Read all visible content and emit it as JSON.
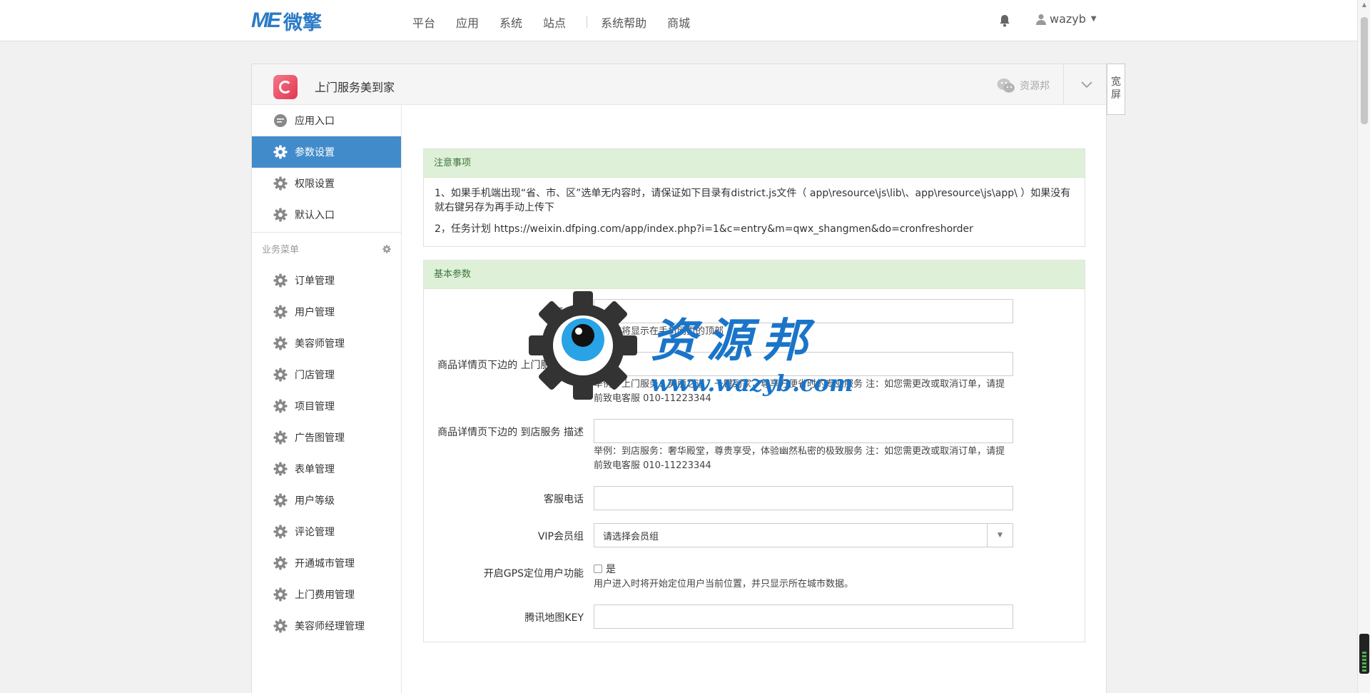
{
  "topbar": {
    "logo_mark": "ME",
    "logo_name": "微擎",
    "nav": [
      "平台",
      "应用",
      "系统",
      "站点",
      "系统帮助",
      "商城"
    ],
    "user": "wazyb"
  },
  "panel": {
    "app_title": "上门服务美到家",
    "wx_label": "资源邦",
    "wide_button": "宽屏"
  },
  "sidebar": {
    "top_items": [
      {
        "label": "应用入口",
        "icon": "chat-bubble-icon"
      },
      {
        "label": "参数设置",
        "icon": "gear-icon",
        "active": true
      },
      {
        "label": "权限设置",
        "icon": "gear-icon"
      },
      {
        "label": "默认入口",
        "icon": "gear-icon"
      }
    ],
    "group_title": "业务菜单",
    "menu": [
      "订单管理",
      "用户管理",
      "美容师管理",
      "门店管理",
      "项目管理",
      "广告图管理",
      "表单管理",
      "用户等级",
      "评论管理",
      "开通城市管理",
      "上门费用管理",
      "美容师经理管理"
    ]
  },
  "notice": {
    "title": "注意事项",
    "line1": "1、如果手机端出现“省、市、区”选单无内容时，请保证如下目录有district.js文件（ app\\resource\\js\\lib\\、app\\resource\\js\\app\\ ）如果没有就右键另存为再手动上传下",
    "line2": "2，任务计划 https://weixin.dfping.com/app/index.php?i=1&c=entry&m=qwx_shangmen&do=cronfreshorder"
  },
  "basic": {
    "title": "基本参数",
    "platform_label": "平台名",
    "platform_help": "该名称将显示在手机网页的顶部",
    "door_label": "商品详情页下边的 上门服务 描述",
    "door_help": "举例：上门服务：美丽之道，一键到家，尊享方便省时的专业服务 注：如您需更改或取消订单，请提前致电客服 010-11223344",
    "store_label": "商品详情页下边的 到店服务 描述",
    "store_help": "举例：到店服务：奢华殿堂，尊贵享受，体验幽然私密的极致服务 注：如您需更改或取消订单，请提前致电客服 010-11223344",
    "phone_label": "客服电话",
    "vip_label": "VIP会员组",
    "vip_value": "请选择会员组",
    "gps_label": "开启GPS定位用户功能",
    "gps_option": "是",
    "gps_help": "用户进入时将开始定位用户当前位置，并只显示所在城市数据。",
    "map_label": "腾讯地图KEY"
  },
  "watermark": {
    "text": "资源邦",
    "url": "www.wazyb.com"
  },
  "colors": {
    "primary": "#428bca",
    "notice_bg": "#dff0d8",
    "notice_text": "#3c763d",
    "logo": "#2b7ac6"
  }
}
